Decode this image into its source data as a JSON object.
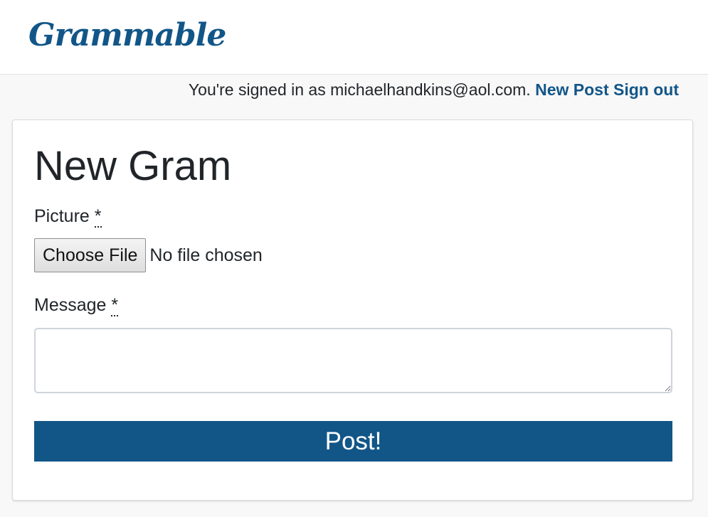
{
  "navbar": {
    "brand": "Grammable"
  },
  "session": {
    "signed_in_text": "You're signed in as michaelhandkins@aol.com.",
    "new_post_label": "New Post",
    "sign_out_label": "Sign out"
  },
  "form": {
    "title": "New Gram",
    "picture_label": "Picture",
    "required_marker": "*",
    "choose_file_label": "Choose File",
    "file_status": "No file chosen",
    "message_label": "Message",
    "message_value": "",
    "submit_label": "Post!"
  },
  "colors": {
    "brand": "#125688",
    "background": "#f8f8f8",
    "card": "#ffffff"
  }
}
